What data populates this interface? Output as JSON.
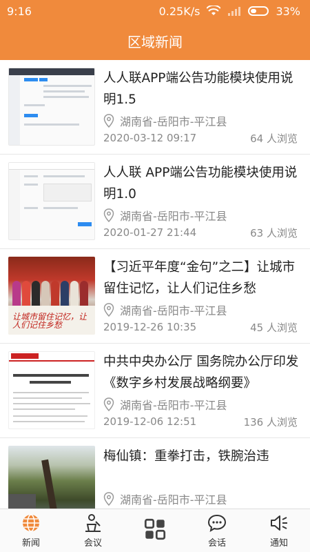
{
  "status_bar": {
    "time": "9:16",
    "network_speed": "0.25K/s",
    "battery": "33%"
  },
  "header": {
    "title": "区域新闻"
  },
  "colors": {
    "accent": "#f08a3c",
    "active_tab": "#f08a3c"
  },
  "news": [
    {
      "title": "人人联APP端公告功能模块使用说明1.5",
      "location": "湖南省-岳阳市-平江县",
      "date": "2020-03-12 09:17",
      "views": "64  人浏览"
    },
    {
      "title": "人人联 APP端公告功能模块使用说明1.0",
      "location": "湖南省-岳阳市-平江县",
      "date": "2020-01-27 21:44",
      "views": "63  人浏览"
    },
    {
      "title": "【习近平年度“金句”之二】让城市留住记忆，让人们记住乡愁",
      "location": "湖南省-岳阳市-平江县",
      "date": "2019-12-26 10:35",
      "views": "45  人浏览",
      "thumb_text": "让城市留住记忆，让人们记住乡愁"
    },
    {
      "title": "中共中央办公厅 国务院办公厅印发《数字乡村发展战略纲要》",
      "location": "湖南省-岳阳市-平江县",
      "date": "2019-12-06 12:51",
      "views": "136  人浏览"
    },
    {
      "title": "梅仙镇：重拳打击，铁腕治违",
      "location": "湖南省-岳阳市-平江县",
      "date": "",
      "views": ""
    }
  ],
  "tabs": [
    {
      "label": "新闻",
      "icon": "globe-icon"
    },
    {
      "label": "会议",
      "icon": "podium-icon"
    },
    {
      "label": "",
      "icon": "grid-icon"
    },
    {
      "label": "会话",
      "icon": "chat-icon"
    },
    {
      "label": "通知",
      "icon": "speaker-icon"
    }
  ]
}
